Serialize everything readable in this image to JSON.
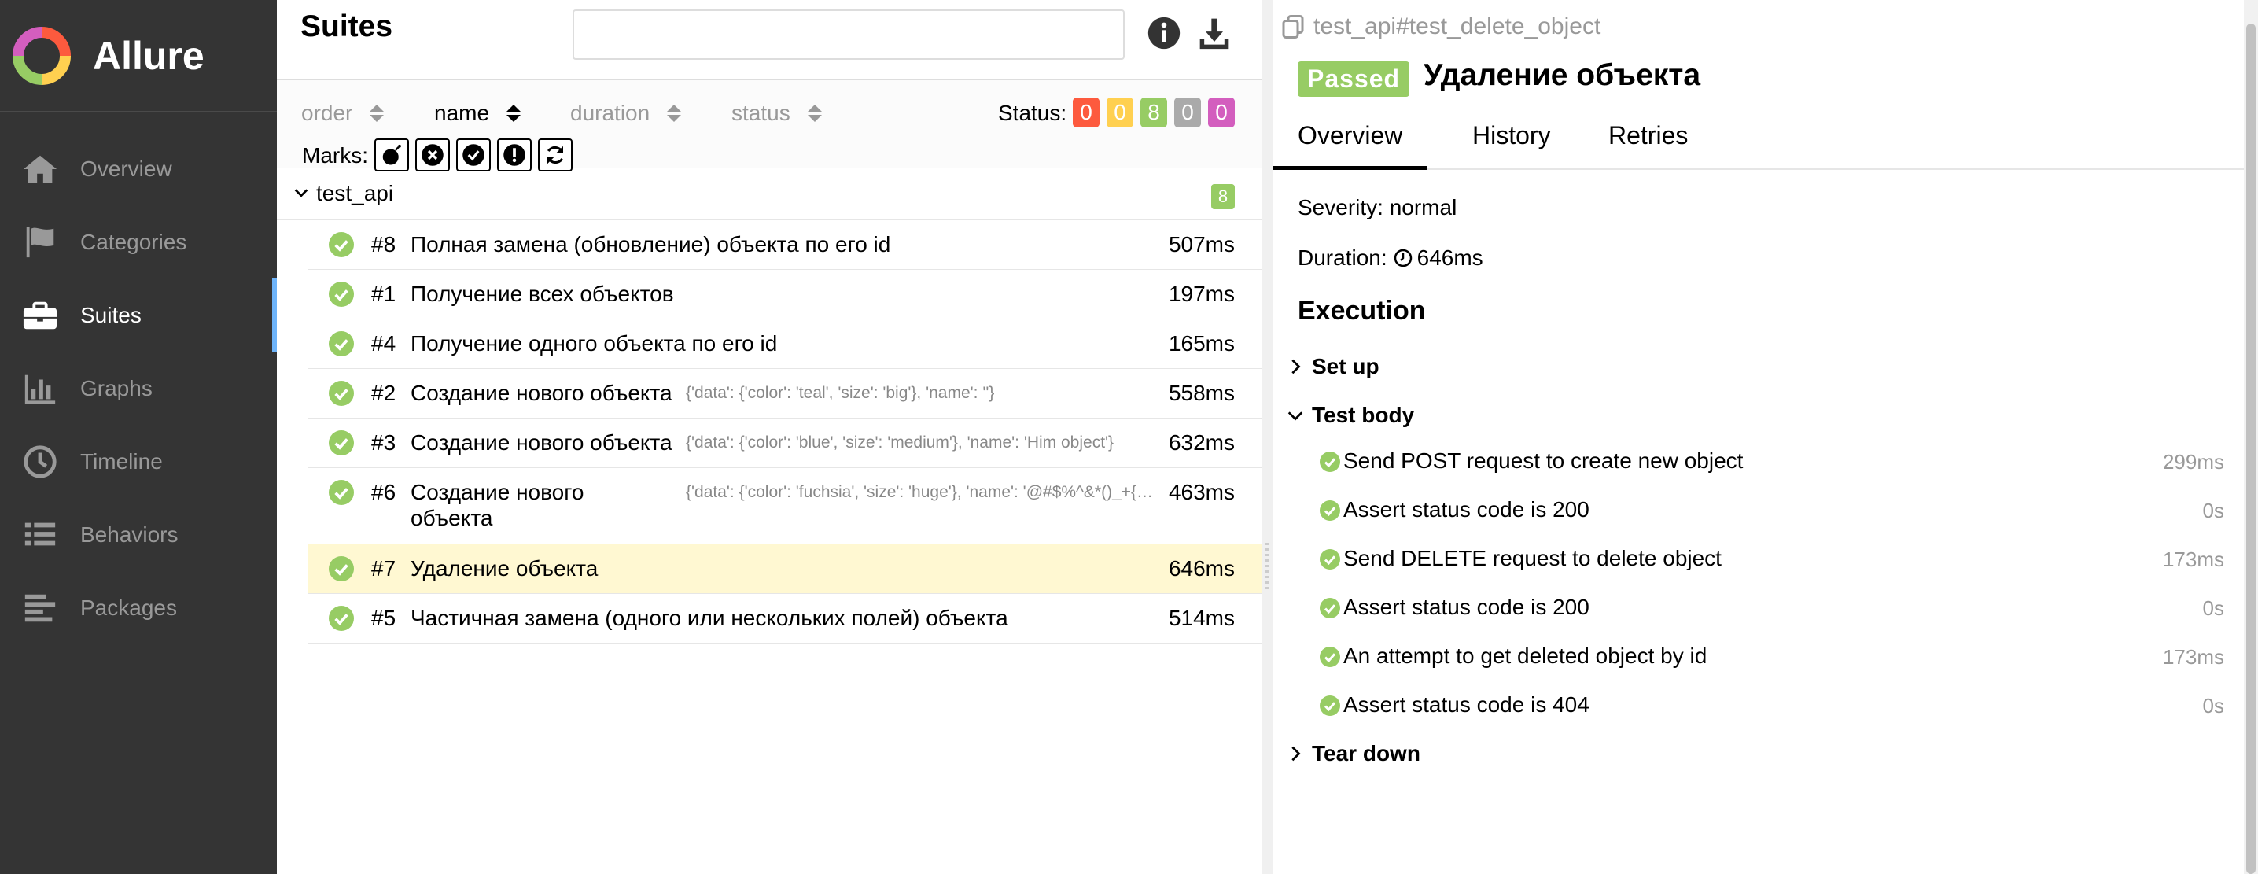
{
  "brand": {
    "name": "Allure",
    "logo_icon": "allure-logo-icon"
  },
  "sidebar": {
    "items": [
      {
        "label": "Overview",
        "icon": "home-icon"
      },
      {
        "label": "Categories",
        "icon": "flag-icon"
      },
      {
        "label": "Suites",
        "icon": "briefcase-icon",
        "active": true
      },
      {
        "label": "Graphs",
        "icon": "bar-chart-icon"
      },
      {
        "label": "Timeline",
        "icon": "clock-icon"
      },
      {
        "label": "Behaviors",
        "icon": "list-icon"
      },
      {
        "label": "Packages",
        "icon": "align-left-icon"
      }
    ]
  },
  "suites_panel": {
    "title": "Suites",
    "search": {
      "value": "",
      "placeholder": ""
    },
    "sort": {
      "order": "order",
      "name": "name",
      "duration": "duration",
      "status": "status"
    },
    "status_label": "Status:",
    "status_counts": [
      {
        "value": "0",
        "color": "#fd5a3e"
      },
      {
        "value": "0",
        "color": "#ffd050"
      },
      {
        "value": "8",
        "color": "#97cc64"
      },
      {
        "value": "0",
        "color": "#aaaaaa"
      },
      {
        "value": "0",
        "color": "#d35ebe"
      }
    ],
    "marks_label": "Marks:",
    "suite": {
      "name": "test_api",
      "count": "8"
    },
    "rows": [
      {
        "num": "#8",
        "name": "Полная замена (обновление) объекта по его id",
        "params": "",
        "duration": "507ms"
      },
      {
        "num": "#1",
        "name": "Получение всех объектов",
        "params": "",
        "duration": "197ms"
      },
      {
        "num": "#4",
        "name": "Получение одного объекта по его id",
        "params": "",
        "duration": "165ms"
      },
      {
        "num": "#2",
        "name": "Создание нового объекта",
        "params": "{'data': {'color': 'teal', 'size': 'big'}, 'name': ''}",
        "duration": "558ms"
      },
      {
        "num": "#3",
        "name": "Создание нового объекта",
        "params": "{'data': {'color': 'blue', 'size': 'medium'}, 'name': 'Him object'}",
        "duration": "632ms"
      },
      {
        "num": "#6",
        "name": "Создание нового объекта",
        "params": "{'data': {'color': 'fuchsia', 'size': 'huge'}, 'name': '@#$%^&*()_+{}|:\"<>?'}",
        "duration": "463ms"
      },
      {
        "num": "#7",
        "name": "Удаление объекта",
        "params": "",
        "duration": "646ms",
        "selected": true
      },
      {
        "num": "#5",
        "name": "Частичная замена (одного или нескольких полей) объекта",
        "params": "",
        "duration": "514ms"
      }
    ]
  },
  "detail": {
    "path": "test_api#test_delete_object",
    "status": "Passed",
    "title": "Удаление объекта",
    "tabs": [
      "Overview",
      "History",
      "Retries"
    ],
    "severity": "Severity: normal",
    "duration_label": "Duration:",
    "duration": "646ms",
    "execution": "Execution",
    "setup": "Set up",
    "test_body": "Test body",
    "teardown": "Tear down",
    "steps": [
      {
        "name": "Send POST request to create new object",
        "duration": "299ms"
      },
      {
        "name": "Assert status code is 200",
        "duration": "0s"
      },
      {
        "name": "Send DELETE request to delete object",
        "duration": "173ms"
      },
      {
        "name": "Assert status code is 200",
        "duration": "0s"
      },
      {
        "name": "An attempt to get deleted object by id",
        "duration": "173ms"
      },
      {
        "name": "Assert status code is 404",
        "duration": "0s"
      }
    ]
  }
}
